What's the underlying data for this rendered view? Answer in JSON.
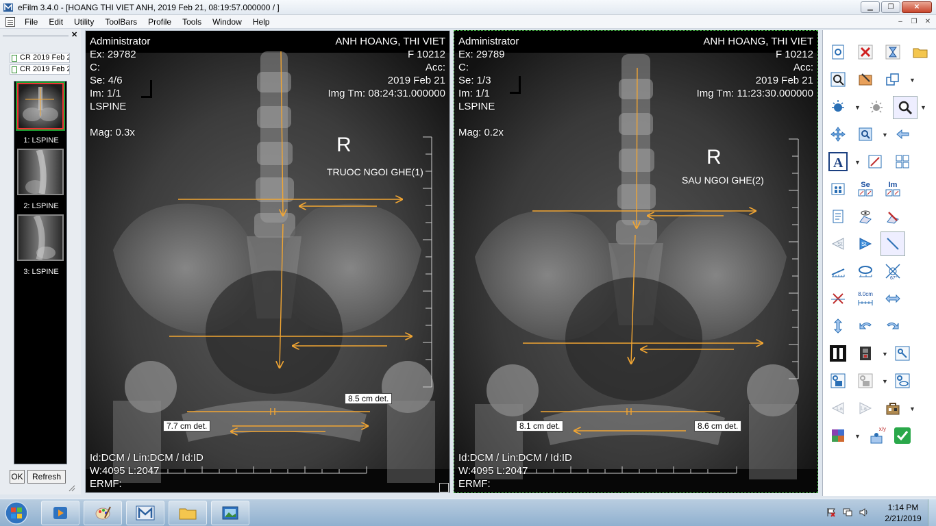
{
  "window": {
    "title": "eFilm 3.4.0 - [HOANG THI VIET ANH, 2019 Feb 21, 08:19:57.000000  /  ]",
    "controls": [
      "minimize",
      "restore",
      "close"
    ]
  },
  "menu": [
    "File",
    "Edit",
    "Utility",
    "ToolBars",
    "Profile",
    "Tools",
    "Window",
    "Help"
  ],
  "left_panel": {
    "studies": [
      "CR 2019 Feb 2",
      "CR 2019 Feb 2"
    ],
    "series": [
      {
        "label": "1:  LSPINE",
        "selected": true
      },
      {
        "label": "2:  LSPINE",
        "selected": false
      },
      {
        "label": "3:  LSPINE",
        "selected": false
      }
    ],
    "ok_label": "OK",
    "refresh_label": "Refresh"
  },
  "viewports": [
    {
      "user": "Administrator",
      "exam": "Ex: 29782",
      "c": "C:",
      "series": "Se: 4/6",
      "image": "Im: 1/1",
      "body_part": "LSPINE",
      "mag": "Mag: 0.3x",
      "patient": "ANH HOANG, THI VIET",
      "id": "F 10212",
      "acc": "Acc:",
      "date": "2019 Feb 21",
      "img_time": "Img Tm: 08:24:31.000000",
      "side_marker": "R",
      "annotation": "TRUOC NGOI GHE(1)",
      "measure_a": "8.5 cm det.",
      "measure_b": "7.7 cm det.",
      "lut": "Id:DCM / Lin:DCM / Id:ID",
      "window_level": "W:4095  L:2047",
      "ermf": "ERMF:"
    },
    {
      "user": "Administrator",
      "exam": "Ex: 29789",
      "c": "C:",
      "series": "Se: 1/3",
      "image": "Im: 1/1",
      "body_part": "LSPINE",
      "mag": "Mag: 0.2x",
      "patient": "ANH HOANG, THI VIET",
      "id": "F 10212",
      "acc": "Acc:",
      "date": "2019 Feb 21",
      "img_time": "Img Tm: 11:23:30.000000",
      "side_marker": "R",
      "annotation": "SAU NGOI GHE(2)",
      "measure_a": "8.1 cm det.",
      "measure_b": "8.6 cm det.",
      "lut": "Id:DCM / Lin:DCM / Id:ID",
      "window_level": "W:4095  L:2047",
      "ermf": "ERMF:"
    }
  ],
  "toolbar": {
    "se_label": "Se",
    "im_label": "Im",
    "st_label": "St",
    "la_label": "La",
    "ruler_label": "8.0cm",
    "angle_label": "67°",
    "xy_label": "x/y",
    "icons": [
      "new-study-icon",
      "delete-icon",
      "hourglass-icon",
      "open-folder-icon",
      "search-icon",
      "edit-icon",
      "layout-icon",
      "brightness-icon",
      "contrast-icon",
      "magnify-icon",
      "pan-icon",
      "zoom-icon",
      "back-arrow-icon",
      "text-icon",
      "annotate-icon",
      "grid-layout-icon",
      "patients-icon",
      "series-layout-icon",
      "image-layout-icon",
      "report-icon",
      "view-icon",
      "pen-icon",
      "prev-study-icon",
      "next-study-icon",
      "line-icon",
      "ruler-icon",
      "ellipse-icon",
      "angle-icon",
      "delete-measure-icon",
      "distance-icon",
      "flip-horizontal-icon",
      "flip-vertical-icon",
      "undo-icon",
      "redo-icon",
      "pause-icon",
      "film-icon",
      "key-icon",
      "save-icon",
      "export-icon",
      "viewer-icon",
      "prev-label-icon",
      "next-label-icon",
      "toolbox-icon",
      "plugin-icon",
      "xy-coordinate-icon",
      "ok-check-icon"
    ]
  },
  "taskbar": {
    "time": "1:14 PM",
    "date": "2/21/2019"
  },
  "colors": {
    "measure_line": "#f2a633",
    "active_border": "#48b848"
  }
}
